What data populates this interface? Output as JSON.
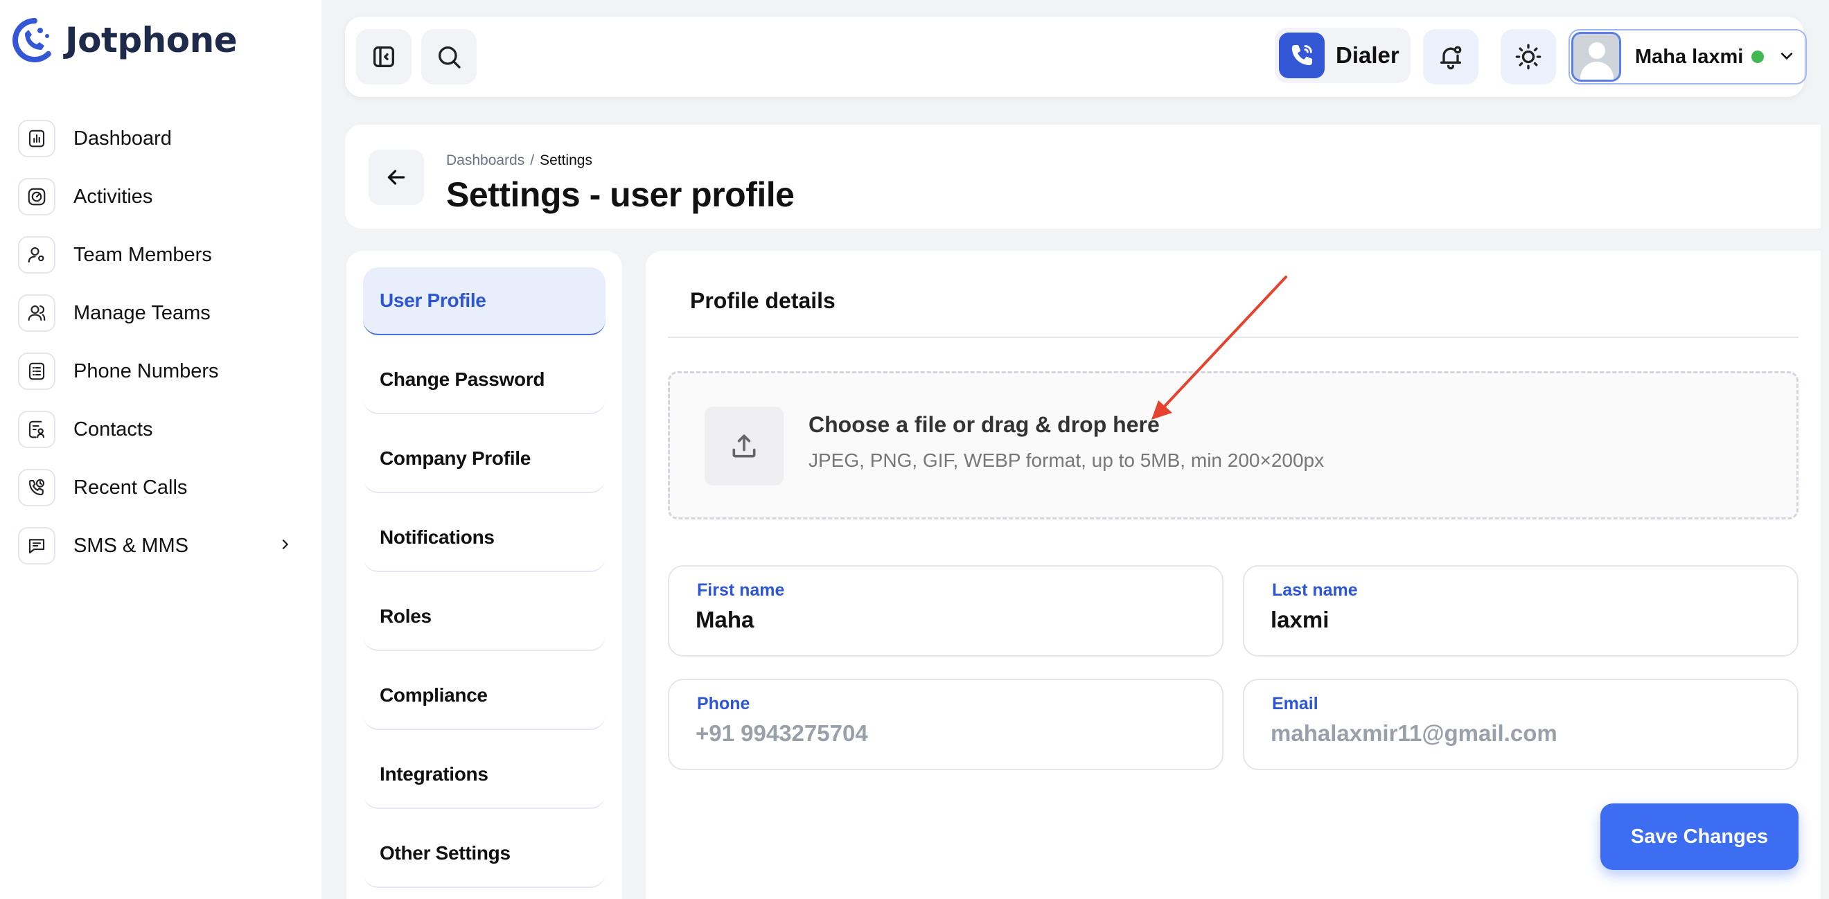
{
  "app": {
    "name": "Jotphone"
  },
  "sidebar": {
    "items": [
      {
        "label": "Dashboard",
        "icon": "bar-chart-icon"
      },
      {
        "label": "Activities",
        "icon": "gauge-icon"
      },
      {
        "label": "Team Members",
        "icon": "user-gear-icon"
      },
      {
        "label": "Manage Teams",
        "icon": "users-icon"
      },
      {
        "label": "Phone Numbers",
        "icon": "list-icon"
      },
      {
        "label": "Contacts",
        "icon": "contact-card-icon"
      },
      {
        "label": "Recent Calls",
        "icon": "phone-history-icon"
      },
      {
        "label": "SMS & MMS",
        "icon": "message-icon",
        "has_submenu": true
      }
    ]
  },
  "topbar": {
    "dialer_label": "Dialer",
    "user_name": "Maha laxmi",
    "user_status": "online"
  },
  "header": {
    "breadcrumb": [
      "Dashboards",
      "Settings"
    ],
    "title": "Settings - user profile"
  },
  "settings_menu": {
    "items": [
      {
        "label": "User Profile",
        "active": true
      },
      {
        "label": "Change Password"
      },
      {
        "label": "Company Profile"
      },
      {
        "label": "Notifications"
      },
      {
        "label": "Roles"
      },
      {
        "label": "Compliance"
      },
      {
        "label": "Integrations"
      },
      {
        "label": "Other Settings"
      }
    ]
  },
  "profile": {
    "section_title": "Profile details",
    "upload": {
      "title": "Choose a file or drag & drop here",
      "subtitle": "JPEG, PNG, GIF, WEBP format, up to 5MB, min 200×200px"
    },
    "fields": {
      "first_name": {
        "label": "First name",
        "value": "Maha"
      },
      "last_name": {
        "label": "Last name",
        "value": "laxmi"
      },
      "phone": {
        "label": "Phone",
        "value": "+91 9943275704"
      },
      "email": {
        "label": "Email",
        "value": "mahalaxmir11@gmail.com"
      }
    },
    "save_label": "Save Changes"
  },
  "colors": {
    "accent": "#3d6df0",
    "active_text": "#2d56d6",
    "online": "#3fb950",
    "annotation_arrow": "#e5432f"
  }
}
